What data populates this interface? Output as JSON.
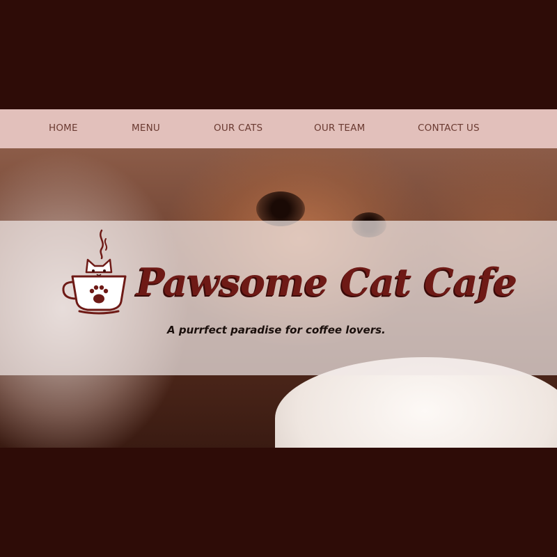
{
  "nav": {
    "items": [
      {
        "label": "HOME"
      },
      {
        "label": "MENU"
      },
      {
        "label": "OUR CATS"
      },
      {
        "label": "OUR TEAM"
      },
      {
        "label": "CONTACT US"
      }
    ]
  },
  "hero": {
    "brand_name": "Pawsome Cat Cafe",
    "tagline": "A purrfect paradise for coffee lovers.",
    "logo_icon": "cat-in-coffee-cup-icon"
  },
  "colors": {
    "page_background": "#2e0c07",
    "nav_background": "#e2c0bb",
    "nav_text": "#6a3a31",
    "brand_text": "#6e1a16"
  }
}
